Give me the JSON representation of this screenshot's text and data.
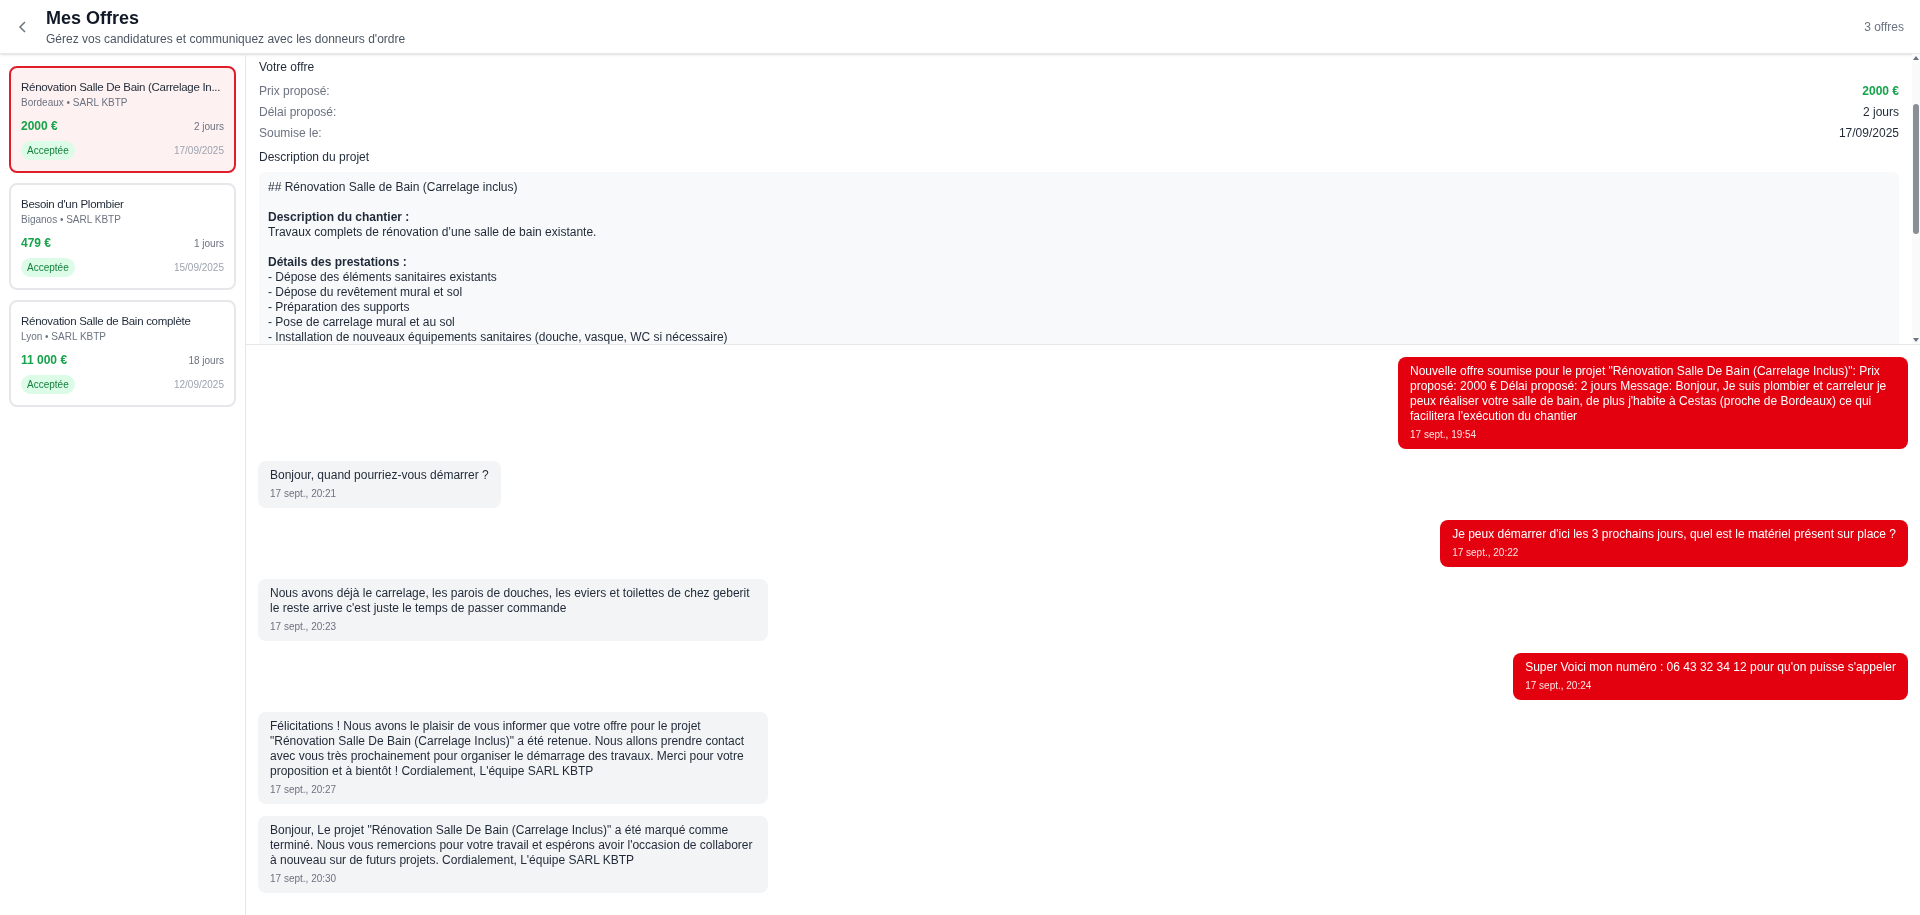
{
  "header": {
    "title": "Mes Offres",
    "subtitle": "Gérez vos candidatures et communiquez avec les donneurs d'ordre",
    "count": "3 offres"
  },
  "offers": [
    {
      "title": "Rénovation Salle De Bain (Carrelage In...",
      "meta": "Bordeaux • SARL KBTP",
      "price": "2000 €",
      "duration": "2 jours",
      "status": "Acceptée",
      "date": "17/09/2025",
      "selected": true
    },
    {
      "title": "Besoin d'un Plombier",
      "meta": "Biganos • SARL KBTP",
      "price": "479 €",
      "duration": "1 jours",
      "status": "Acceptée",
      "date": "15/09/2025",
      "selected": false
    },
    {
      "title": "Rénovation Salle de Bain complète",
      "meta": "Lyon • SARL KBTP",
      "price": "11 000 €",
      "duration": "18 jours",
      "status": "Acceptée",
      "date": "12/09/2025",
      "selected": false
    }
  ],
  "detail": {
    "heading": "Votre offre",
    "fields": [
      {
        "label": "Prix proposé:",
        "value": "2000 €",
        "kind": "price"
      },
      {
        "label": "Délai proposé:",
        "value": "2 jours",
        "kind": "plain"
      },
      {
        "label": "Soumise le:",
        "value": "17/09/2025",
        "kind": "plain"
      }
    ],
    "description_heading": "Description du projet",
    "description": [
      {
        "text": "## Rénovation Salle de Bain (Carrelage inclus)",
        "kind": "plain"
      },
      {
        "text": "Description du chantier :",
        "kind": "section"
      },
      {
        "text": "Travaux complets de rénovation d’une salle de bain existante.",
        "kind": "plain"
      },
      {
        "text": "Détails des prestations :",
        "kind": "section"
      },
      {
        "text": "- Dépose des éléments sanitaires existants",
        "kind": "plain"
      },
      {
        "text": "- Dépose du revêtement mural et sol",
        "kind": "plain"
      },
      {
        "text": "- Préparation des supports",
        "kind": "plain"
      },
      {
        "text": "- Pose de carrelage mural et au sol",
        "kind": "plain"
      },
      {
        "text": "- Installation de nouveaux équipements sanitaires (douche, vasque, WC si nécessaire)",
        "kind": "plain"
      }
    ]
  },
  "messages": [
    {
      "kind": "sent",
      "text": "Nouvelle offre soumise pour le projet \"Rénovation Salle De Bain (Carrelage Inclus)\": Prix proposé: 2000 € Délai proposé: 2 jours Message: Bonjour, Je suis plombier et carreleur je peux réaliser votre salle de bain, de plus j'habite à Cestas (proche de Bordeaux) ce qui facilitera l'exécution du chantier",
      "time": "17 sept., 19:54"
    },
    {
      "kind": "received",
      "text": "Bonjour, quand pourriez-vous démarrer ?",
      "time": "17 sept., 20:21"
    },
    {
      "kind": "sent",
      "text": "Je peux démarrer d'ici les 3 prochains jours, quel est le matériel présent sur place ?",
      "time": "17 sept., 20:22"
    },
    {
      "kind": "received",
      "text": "Nous avons déjà le carrelage, les parois de douches, les eviers et toilettes de chez geberit le reste arrive c'est juste le temps de passer commande",
      "time": "17 sept., 20:23"
    },
    {
      "kind": "sent",
      "text": "Super Voici mon numéro : 06 43 32 34 12 pour qu'on puisse s'appeler",
      "time": "17 sept., 20:24"
    },
    {
      "kind": "received",
      "text": "Félicitations ! Nous avons le plaisir de vous informer que votre offre pour le projet \"Rénovation Salle De Bain (Carrelage Inclus)\" a été retenue. Nous allons prendre contact avec vous très prochainement pour organiser le démarrage des travaux. Merci pour votre proposition et à bientôt ! Cordialement, L'équipe SARL KBTP",
      "time": "17 sept., 20:27"
    },
    {
      "kind": "received",
      "text": "Bonjour, Le projet \"Rénovation Salle De Bain (Carrelage Inclus)\" a été marqué comme terminé. Nous vous remercions pour votre travail et espérons avoir l'occasion de collaborer à nouveau sur de futurs projets. Cordialement, L'équipe SARL KBTP",
      "time": "17 sept., 20:30"
    }
  ]
}
